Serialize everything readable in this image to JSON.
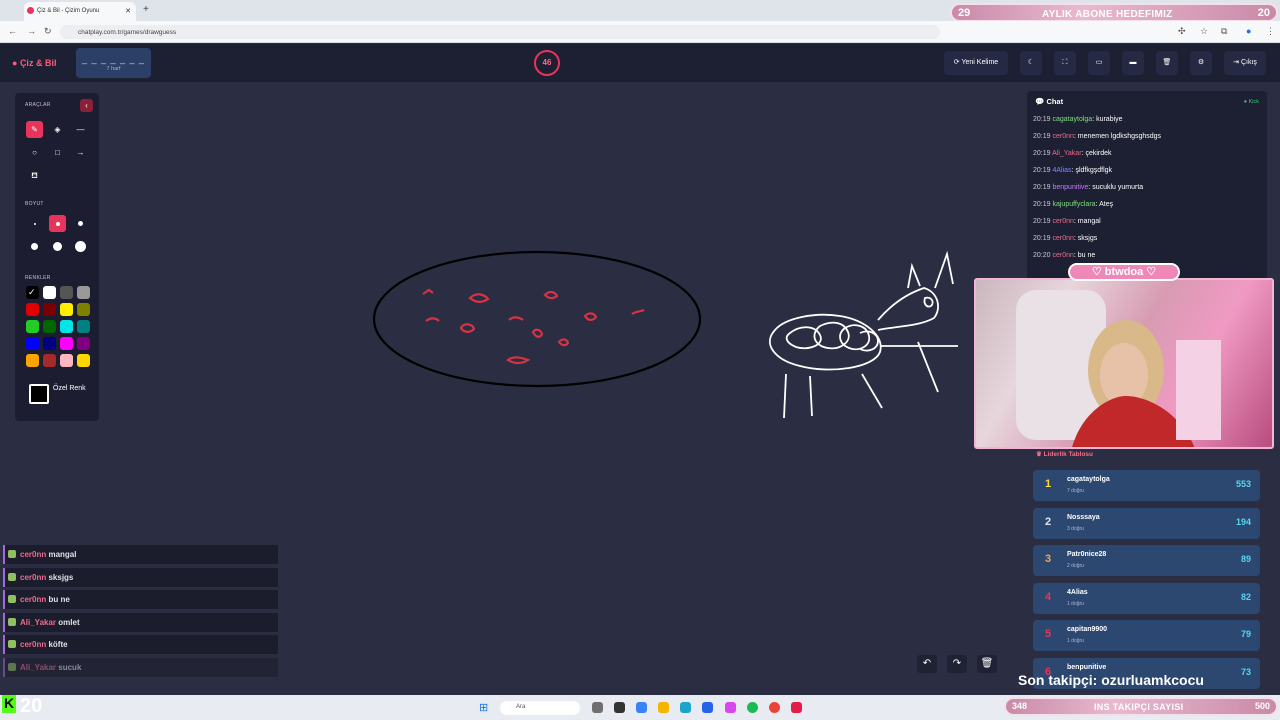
{
  "browser": {
    "tab_title": "Çiz & Bil - Çizim Oyunu",
    "url": "chatplay.com.tr/games/drawguess"
  },
  "subs_goal": {
    "current": "29",
    "label": "AYLIK ABONE HEDEFIMIZ",
    "goal": "20"
  },
  "header": {
    "logo": "Çiz & Bil",
    "word_mask": "_ _ _ _ _ _ _",
    "word_hint": "7 harf",
    "timer": "46",
    "new_word": "Yeni Kelime",
    "exit": "Çıkış"
  },
  "tools": {
    "title": "ARAÇLAR",
    "size_title": "BOYUT",
    "colors_title": "RENKLER",
    "custom_color": "Özel Renk",
    "colors": [
      "#000000",
      "#ffffff",
      "#555555",
      "#999999",
      "#e00000",
      "#7a0000",
      "#ffee00",
      "#808000",
      "#22cc22",
      "#006600",
      "#00e5e5",
      "#008080",
      "#0000ff",
      "#000080",
      "#ff00ff",
      "#800080",
      "#ffa500",
      "#a52a2a",
      "#ffb6c1",
      "#ffd700"
    ],
    "icons": [
      "brush-icon",
      "eraser-icon",
      "line-icon",
      "circle-icon",
      "rectangle-icon",
      "arrow-icon",
      "fill-icon"
    ]
  },
  "overlay_chat": [
    {
      "user": "cer0nn",
      "text": "mangal"
    },
    {
      "user": "cer0nn",
      "text": "sksjgs"
    },
    {
      "user": "cer0nn",
      "text": "bu ne"
    },
    {
      "user": "Ali_Yakar",
      "text": "omlet"
    },
    {
      "user": "cer0nn",
      "text": "köfte"
    },
    {
      "user": "Ali_Yakar",
      "text": "sucuk"
    }
  ],
  "chat": {
    "title": "Chat",
    "kick": "Kick",
    "messages": [
      {
        "time": "20:19",
        "user": "cagataytolga",
        "color": "#7be07b",
        "text": "kurabiye"
      },
      {
        "time": "20:19",
        "user": "cer0nn",
        "color": "#f06a8c",
        "text": "menemen lgdkshgsghsdgs"
      },
      {
        "time": "20:19",
        "user": "Ali_Yakar",
        "color": "#f06a8c",
        "text": "çekirdek"
      },
      {
        "time": "20:19",
        "user": "4Alias",
        "color": "#7f8cff",
        "text": "şldfkgşdflgk"
      },
      {
        "time": "20:19",
        "user": "benpunitive",
        "color": "#c67bff",
        "text": "sucuklu yumurta"
      },
      {
        "time": "20:19",
        "user": "kajupuffyclara",
        "color": "#7be07b",
        "text": "Ateş"
      },
      {
        "time": "20:19",
        "user": "cer0nn",
        "color": "#f06a8c",
        "text": "mangal"
      },
      {
        "time": "20:19",
        "user": "cer0nn",
        "color": "#f06a8c",
        "text": "sksjgs"
      },
      {
        "time": "20:20",
        "user": "cer0nn",
        "color": "#f06a8c",
        "text": "bu ne"
      }
    ]
  },
  "streamer": "btwdoa",
  "leaderboard": {
    "title": "Liderlik Tablosu",
    "rows": [
      {
        "rank": "1",
        "name": "cagataytolga",
        "correct": "7 doğru",
        "score": "553",
        "color": "#ffd93b"
      },
      {
        "rank": "2",
        "name": "Nosssaya",
        "correct": "3 doğru",
        "score": "194",
        "color": "#dfe3ee"
      },
      {
        "rank": "3",
        "name": "Patr0nice28",
        "correct": "2 doğru",
        "score": "89",
        "color": "#f0a35b"
      },
      {
        "rank": "4",
        "name": "4Alias",
        "correct": "1 doğru",
        "score": "82",
        "color": "#e8345a"
      },
      {
        "rank": "5",
        "name": "capitan9900",
        "correct": "1 doğru",
        "score": "79",
        "color": "#e8345a"
      },
      {
        "rank": "6",
        "name": "benpunitive",
        "correct": "",
        "score": "73",
        "color": "#e8345a"
      }
    ]
  },
  "follower": "Son takipçi: ozurluamkcocu",
  "kick_count": "20",
  "taskbar": {
    "search": "Ara"
  },
  "insta": {
    "current": "348",
    "label": "INS TAKIPÇI SAYISI",
    "goal": "500"
  }
}
